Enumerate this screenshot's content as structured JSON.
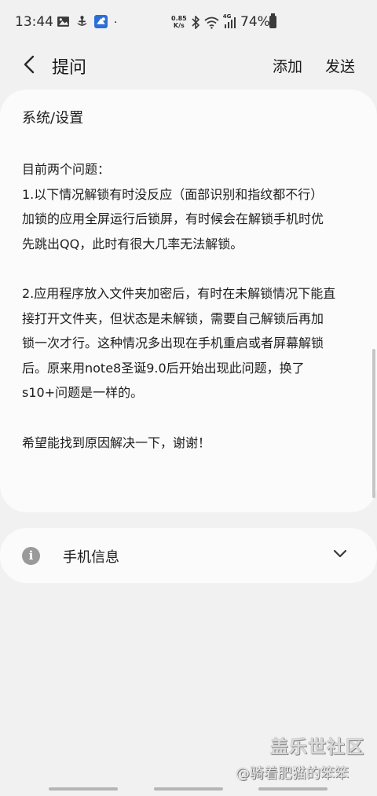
{
  "status_bar": {
    "time": "13:44",
    "net_speed_value": "0.85",
    "net_speed_unit": "K/s",
    "network_type": "4G",
    "battery_percent": "74%",
    "left_icons": [
      "image-icon",
      "ship-icon",
      "app-notification-icon",
      "dot-icon"
    ],
    "right_icons": [
      "bluetooth-icon",
      "wifi-icon",
      "signal-icon",
      "battery-icon"
    ]
  },
  "header": {
    "title": "提问",
    "add_label": "添加",
    "send_label": "发送"
  },
  "card": {
    "category": "系统/设置",
    "paragraphs": [
      [
        "目前两个问题："
      ],
      [
        "1.以下情况解锁有时没反应（面部识别和指纹都不行）",
        "加锁的应用全屏运行后锁屏，有时候会在解锁手机时优",
        "先跳出QQ，此时有很大几率无法解锁。"
      ],
      [
        "2.应用程序放入文件夹加密后，有时在未解锁情况下能直",
        "接打开文件夹，但状态是未解锁，需要自己解锁后再加",
        "锁一次才行。这种情况多出现在手机重启或者屏幕解锁",
        "后。原来用note8圣诞9.0后开始出现此问题，换了",
        "s10+问题是一样的。"
      ],
      [
        "希望能找到原因解决一下，谢谢！"
      ]
    ]
  },
  "device_info": {
    "icon_glyph": "i",
    "label": "手机信息"
  },
  "watermark": {
    "brand": "盖乐世社区",
    "author": "@骑着肥猫的笨笨"
  }
}
